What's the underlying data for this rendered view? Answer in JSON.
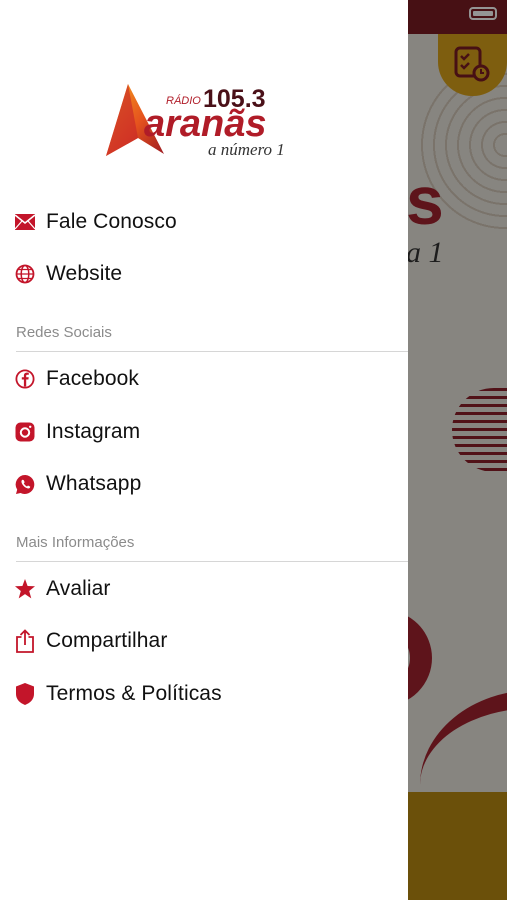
{
  "colors": {
    "accent": "#c3152a",
    "text": "#111111",
    "section": "#8b8b8b"
  },
  "logo": {
    "radio": "RÁDIO",
    "frequency": "105.3",
    "name": "aranãs",
    "tagline": "a número 1"
  },
  "menu": {
    "top": [
      {
        "label": "Fale Conosco",
        "icon": "envelope-icon"
      },
      {
        "label": "Website",
        "icon": "globe-icon"
      }
    ],
    "social_title": "Redes Sociais",
    "social": [
      {
        "label": "Facebook",
        "icon": "facebook-icon"
      },
      {
        "label": "Instagram",
        "icon": "instagram-icon"
      },
      {
        "label": "Whatsapp",
        "icon": "whatsapp-icon"
      }
    ],
    "info_title": "Mais Informações",
    "info": [
      {
        "label": "Avaliar",
        "icon": "star-icon"
      },
      {
        "label": "Compartilhar",
        "icon": "share-icon"
      },
      {
        "label": "Termos & Políticas",
        "icon": "shield-icon"
      }
    ]
  },
  "background": {
    "big_letter": "s",
    "script_text": "a 1"
  }
}
